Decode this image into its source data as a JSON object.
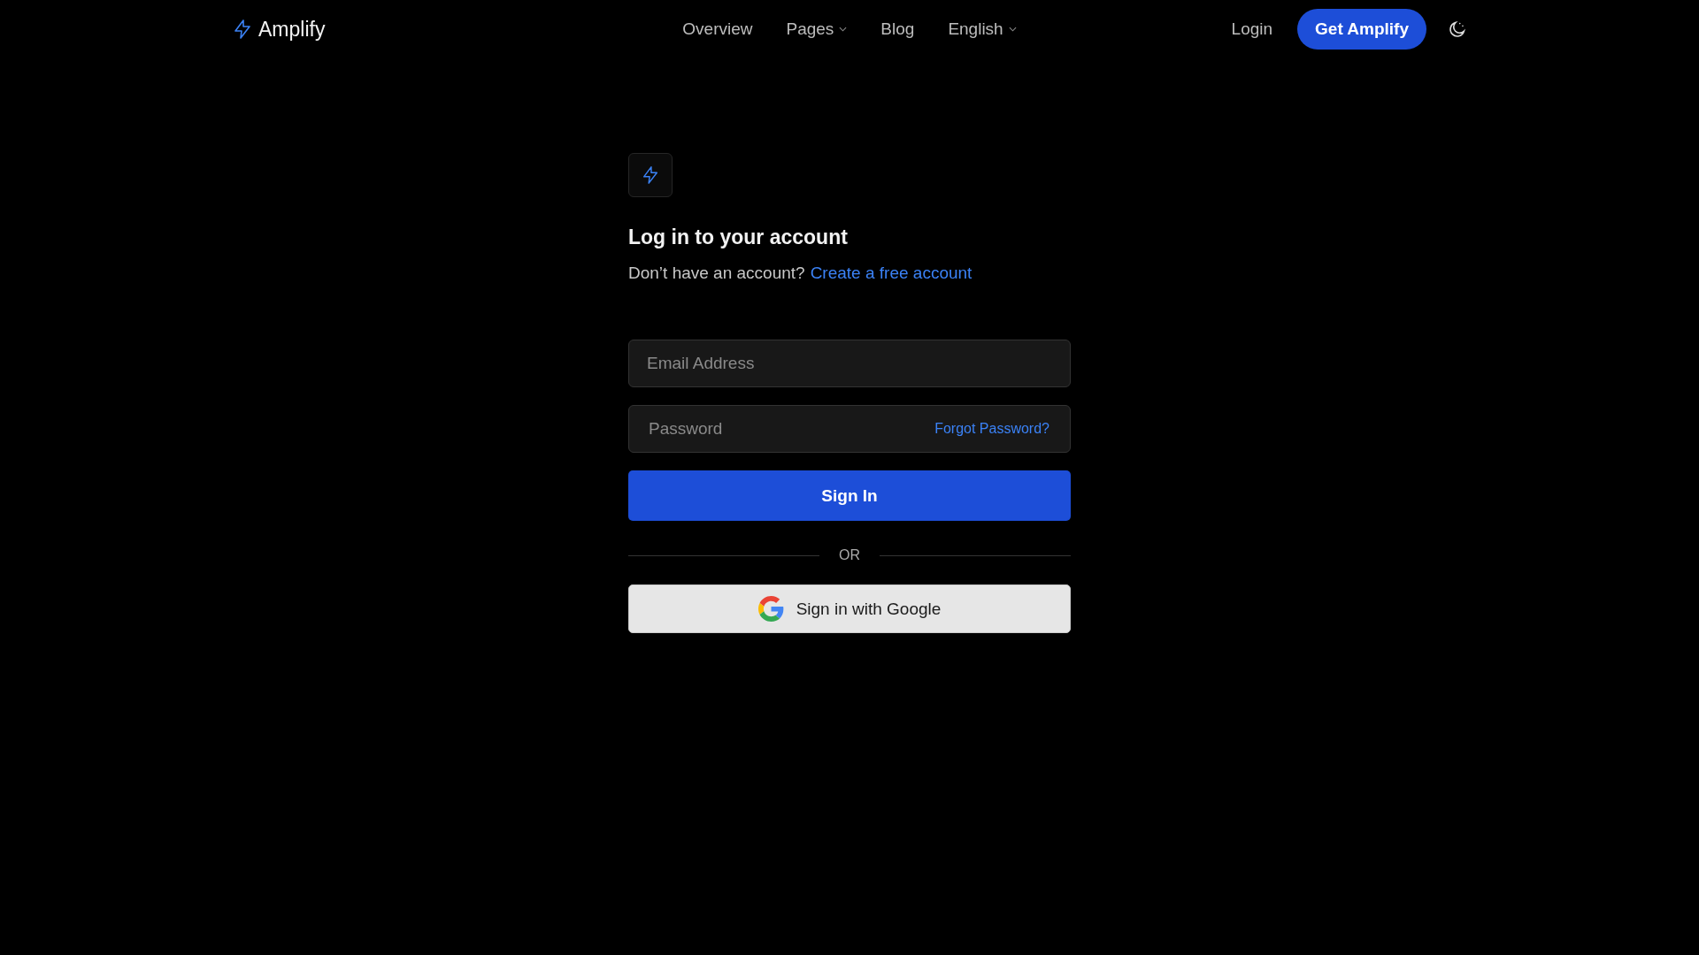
{
  "header": {
    "brand": "Amplify",
    "nav": [
      {
        "label": "Overview",
        "dropdown": false
      },
      {
        "label": "Pages",
        "dropdown": true
      },
      {
        "label": "Blog",
        "dropdown": false
      },
      {
        "label": "English",
        "dropdown": true
      }
    ],
    "login": "Login",
    "cta": "Get Amplify"
  },
  "form": {
    "title": "Log in to your account",
    "prompt": "Don’t have an account?",
    "signup_link": "Create a free account",
    "email": {
      "placeholder": "Email Address"
    },
    "password": {
      "placeholder": "Password"
    },
    "forgot": "Forgot Password?",
    "submit": "Sign In",
    "divider": "OR",
    "google": "Sign in with Google"
  }
}
